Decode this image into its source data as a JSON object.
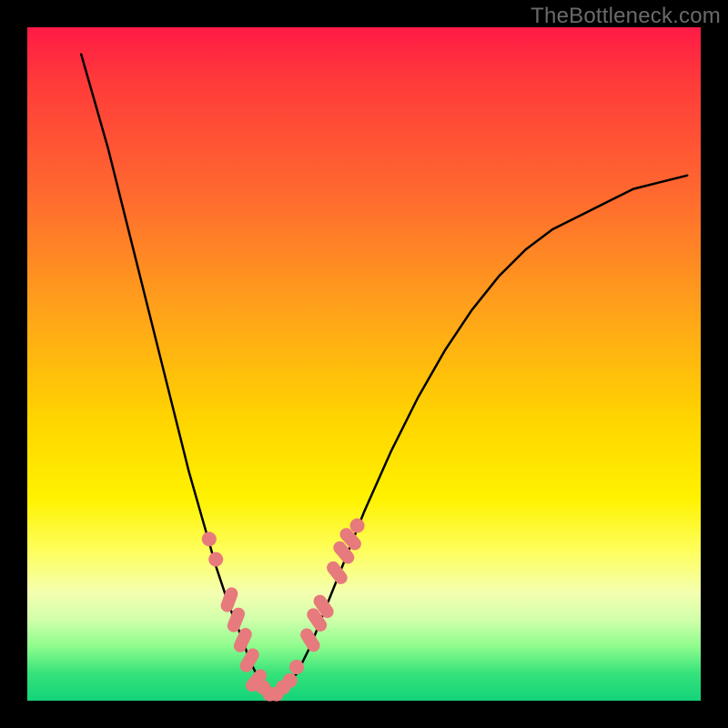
{
  "watermark": "TheBottleneck.com",
  "colors": {
    "background": "#000000",
    "gradient_top": "#ff1a46",
    "gradient_mid1": "#ffa21a",
    "gradient_mid2": "#fff200",
    "gradient_bottom": "#14d37a",
    "line": "#000000",
    "marker": "#e77a7c"
  },
  "chart_data": {
    "type": "line",
    "title": "",
    "xlabel": "",
    "ylabel": "",
    "xlim": [
      0,
      100
    ],
    "ylim": [
      0,
      100
    ],
    "grid": false,
    "legend": false,
    "series": [
      {
        "name": "bottleneck-curve",
        "x": [
          8,
          10,
          12,
          14,
          16,
          18,
          20,
          22,
          24,
          26,
          28,
          30,
          32,
          33,
          34,
          35,
          36,
          37,
          38,
          40,
          42,
          44,
          46,
          48,
          50,
          54,
          58,
          62,
          66,
          70,
          74,
          78,
          82,
          86,
          90,
          94,
          98
        ],
        "y": [
          96,
          89,
          82,
          74,
          66,
          58,
          50,
          42,
          34,
          27,
          20,
          14,
          9,
          6,
          4,
          2,
          1,
          1,
          2,
          4,
          8,
          13,
          18,
          23,
          28,
          37,
          45,
          52,
          58,
          63,
          67,
          70,
          72,
          74,
          76,
          77,
          78
        ]
      }
    ],
    "markers": {
      "name": "highlighted-points",
      "color": "#e77a7c",
      "points": [
        {
          "x": 27,
          "y": 24,
          "shape": "dot"
        },
        {
          "x": 28,
          "y": 21,
          "shape": "dot"
        },
        {
          "x": 30,
          "y": 15,
          "shape": "pill",
          "angle": -70
        },
        {
          "x": 31,
          "y": 12,
          "shape": "pill",
          "angle": -68
        },
        {
          "x": 32,
          "y": 9,
          "shape": "pill",
          "angle": -65
        },
        {
          "x": 33,
          "y": 6,
          "shape": "pill",
          "angle": -60
        },
        {
          "x": 34,
          "y": 3,
          "shape": "pill",
          "angle": -50
        },
        {
          "x": 35,
          "y": 2,
          "shape": "dot"
        },
        {
          "x": 36,
          "y": 1,
          "shape": "dot"
        },
        {
          "x": 37,
          "y": 1,
          "shape": "dot"
        },
        {
          "x": 38,
          "y": 2,
          "shape": "dot"
        },
        {
          "x": 39,
          "y": 3,
          "shape": "dot"
        },
        {
          "x": 40,
          "y": 5,
          "shape": "dot"
        },
        {
          "x": 42,
          "y": 9,
          "shape": "pill",
          "angle": 58
        },
        {
          "x": 43,
          "y": 12,
          "shape": "pill",
          "angle": 56
        },
        {
          "x": 44,
          "y": 14,
          "shape": "pill",
          "angle": 55
        },
        {
          "x": 46,
          "y": 19,
          "shape": "pill",
          "angle": 52
        },
        {
          "x": 47,
          "y": 22,
          "shape": "pill",
          "angle": 50
        },
        {
          "x": 48,
          "y": 24,
          "shape": "pill",
          "angle": 48
        },
        {
          "x": 49,
          "y": 26,
          "shape": "dot"
        }
      ]
    }
  }
}
